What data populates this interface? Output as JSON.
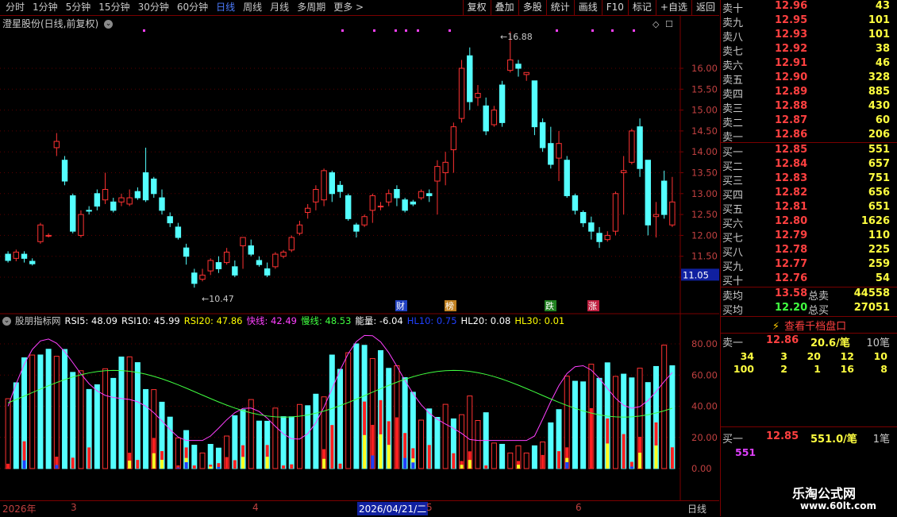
{
  "toolbar": {
    "tabs": [
      "分时",
      "1分钟",
      "5分钟",
      "15分钟",
      "30分钟",
      "60分钟",
      "日线",
      "周线",
      "月线",
      "多周期",
      "更多 >"
    ],
    "active_tab": 6,
    "tools": [
      "复权",
      "叠加",
      "多股",
      "统计",
      "画线",
      "F10",
      "标记",
      "+自选",
      "返回"
    ]
  },
  "stock": {
    "title": "澄星股份(日线,前复权)"
  },
  "main_chart": {
    "price_ticks": [
      "16.00",
      "15.50",
      "15.00",
      "14.50",
      "14.00",
      "13.50",
      "13.00",
      "12.50",
      "12.00",
      "11.50",
      "11.00"
    ],
    "current_price": "11.05",
    "high_label": "16.88",
    "low_label": "10.47",
    "badges": [
      "财",
      "榜",
      "跌",
      "涨"
    ]
  },
  "indicator": {
    "name": "股朋指标网",
    "values": [
      {
        "label": "RSI5: 48.09",
        "color": "#ffffff"
      },
      {
        "label": "RSI10: 45.99",
        "color": "#ffffff"
      },
      {
        "label": "RSI20: 47.86",
        "color": "#ffff00"
      },
      {
        "label": "快线: 42.49",
        "color": "#ff40ff"
      },
      {
        "label": "慢线: 48.53",
        "color": "#40ff40"
      },
      {
        "label": "能量: -6.04",
        "color": "#ffffff"
      },
      {
        "label": "HL10: 0.75",
        "color": "#2040ff"
      },
      {
        "label": "HL20: 0.08",
        "color": "#ffffff"
      },
      {
        "label": "HL30: 0.01",
        "color": "#ffff00"
      }
    ],
    "ticks": [
      "80.00",
      "60.00",
      "40.00",
      "20.00",
      "0.00"
    ]
  },
  "xaxis": {
    "labels": [
      "2026年",
      "3",
      "4",
      "2026/04/21/二",
      "5",
      "6"
    ],
    "period": "日线"
  },
  "orderbook": {
    "sell": [
      {
        "label": "卖十",
        "price": "12.96",
        "vol": "43"
      },
      {
        "label": "卖九",
        "price": "12.95",
        "vol": "101"
      },
      {
        "label": "卖八",
        "price": "12.93",
        "vol": "101"
      },
      {
        "label": "卖七",
        "price": "12.92",
        "vol": "38"
      },
      {
        "label": "卖六",
        "price": "12.91",
        "vol": "46"
      },
      {
        "label": "卖五",
        "price": "12.90",
        "vol": "328"
      },
      {
        "label": "卖四",
        "price": "12.89",
        "vol": "885"
      },
      {
        "label": "卖三",
        "price": "12.88",
        "vol": "430"
      },
      {
        "label": "卖二",
        "price": "12.87",
        "vol": "60"
      },
      {
        "label": "卖一",
        "price": "12.86",
        "vol": "206"
      }
    ],
    "buy": [
      {
        "label": "买一",
        "price": "12.85",
        "vol": "551"
      },
      {
        "label": "买二",
        "price": "12.84",
        "vol": "657"
      },
      {
        "label": "买三",
        "price": "12.83",
        "vol": "751"
      },
      {
        "label": "买四",
        "price": "12.82",
        "vol": "656"
      },
      {
        "label": "买五",
        "price": "12.81",
        "vol": "651"
      },
      {
        "label": "买六",
        "price": "12.80",
        "vol": "1626"
      },
      {
        "label": "买七",
        "price": "12.79",
        "vol": "110"
      },
      {
        "label": "买八",
        "price": "12.78",
        "vol": "225"
      },
      {
        "label": "买九",
        "price": "12.77",
        "vol": "259"
      },
      {
        "label": "买十",
        "price": "12.76",
        "vol": "54"
      }
    ],
    "avg_sell": {
      "label": "卖均",
      "price": "13.58",
      "tlabel": "总卖",
      "total": "44558"
    },
    "avg_buy": {
      "label": "买均",
      "price": "12.20",
      "tlabel": "总买",
      "total": "27051"
    },
    "view_button": "查看千档盘口",
    "sell1": {
      "label": "卖一",
      "price": "12.86",
      "per": "20.6/笔",
      "count": "10笔"
    },
    "sell1_queue": [
      [
        "34",
        "3",
        "20",
        "12",
        "10"
      ],
      [
        "100",
        "2",
        "1",
        "16",
        "8"
      ]
    ],
    "buy1": {
      "label": "买一",
      "price": "12.85",
      "per": "551.0/笔",
      "count": "1笔"
    },
    "buy1_queue": [
      "551"
    ],
    "watermark": "乐淘公式网",
    "watermark_url": "www.60lt.com"
  }
}
